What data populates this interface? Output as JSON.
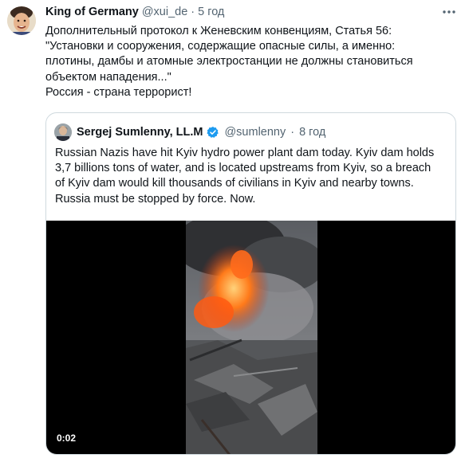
{
  "tweet": {
    "author_name": "King of Germany",
    "handle": "@xui_de",
    "separator": "·",
    "time": "5 год",
    "more_icon": "more-horizontal-icon",
    "lines": [
      "Дополнительный протокол к Женевским конвенциям, Статья 56:",
      "\"Установки и сооружения, содержащие опасные силы, а именно:",
      "плотины, дамбы и атомные электростанции не должны становиться",
      "объектом нападения...\"",
      "Россия - страна террорист!"
    ]
  },
  "quoted": {
    "author_name": "Sergej Sumlenny, LL.M",
    "verified_icon": "verified-badge-icon",
    "handle": "@sumlenny",
    "separator": "·",
    "time": "8 год",
    "lines": [
      "Russian Nazis have hit Kyiv hydro power plant dam today. Kyiv dam holds",
      "3,7 billions tons of water, and is located upstreams from Kyiv, so a breach",
      "of Kyiv dam would kill thousands of civilians in Kyiv and nearby towns.",
      "Russia must be stopped by force. Now."
    ],
    "video": {
      "timestamp": "0:02"
    }
  },
  "colors": {
    "text": "#0f1419",
    "secondary": "#536471",
    "border": "#cfd9de",
    "verified": "#1d9bf0",
    "video_bg": "#000000"
  }
}
